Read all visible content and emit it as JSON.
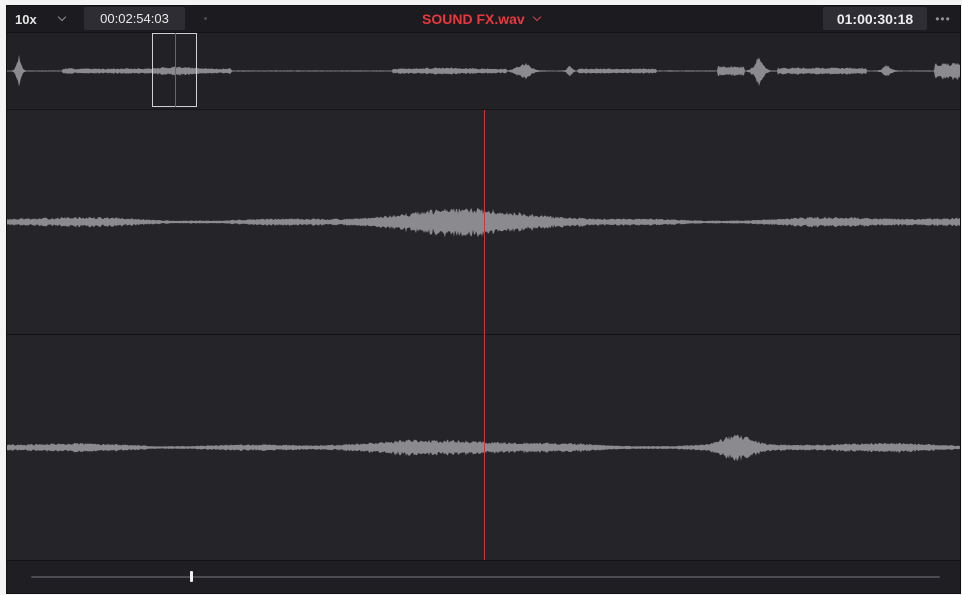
{
  "header": {
    "zoom_label": "10x",
    "source_timecode": "00:02:54:03",
    "clip_name": "SOUND FX.wav",
    "record_timecode": "01:00:30:18",
    "more_label": "•••"
  },
  "colors": {
    "background": "#242328",
    "waveform": "#8b8b8f",
    "playhead": "#d13a3e",
    "clip_name": "#e8383d"
  },
  "overview": {
    "window_start_fraction": 0.152,
    "playhead_fraction": 0.176
  },
  "playhead_fraction": 0.5,
  "scrollbar": {
    "position_fraction": 0.175
  }
}
